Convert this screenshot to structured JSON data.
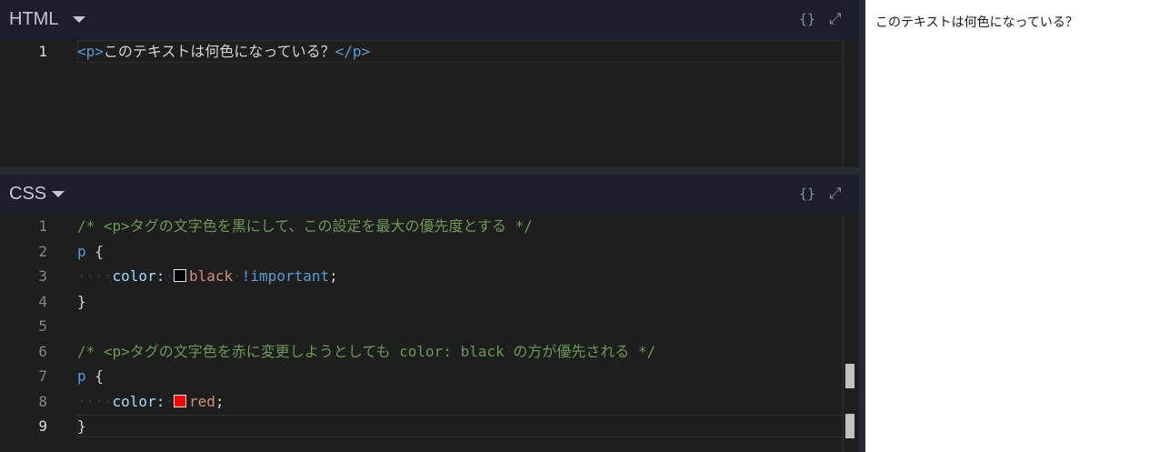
{
  "html_panel": {
    "title": "HTML",
    "format_icon": "{}",
    "expand_icon": "⤢",
    "line_number": "1",
    "code": {
      "open_tag": "<p>",
      "text": "このテキストは何色になっている？",
      "close_tag": "</p>"
    }
  },
  "css_panel": {
    "title": "CSS",
    "format_icon": "{}",
    "expand_icon": "⤢",
    "line_numbers": [
      "1",
      "2",
      "3",
      "4",
      "5",
      "6",
      "7",
      "8",
      "9"
    ],
    "lines": {
      "l1_comment": "/* <p>タグの文字色を黒にして、この設定を最大の優先度とする */",
      "l2_selector": "p",
      "l2_brace": " {",
      "l3_prop": "color:",
      "l3_value": "black",
      "l3_important": "!important",
      "l3_semicolon": ";",
      "l4_brace": "}",
      "l6_comment": "/* <p>タグの文字色を赤に変更しようとしても color: black の方が優先される */",
      "l7_selector": "p",
      "l7_brace": " {",
      "l8_prop": "color:",
      "l8_value": "red",
      "l8_semicolon": ";",
      "l9_brace": "}"
    },
    "swatch_colors": {
      "black": "#000000",
      "red": "#ff0000"
    }
  },
  "preview": {
    "text": "このテキストは何色になっている？"
  }
}
